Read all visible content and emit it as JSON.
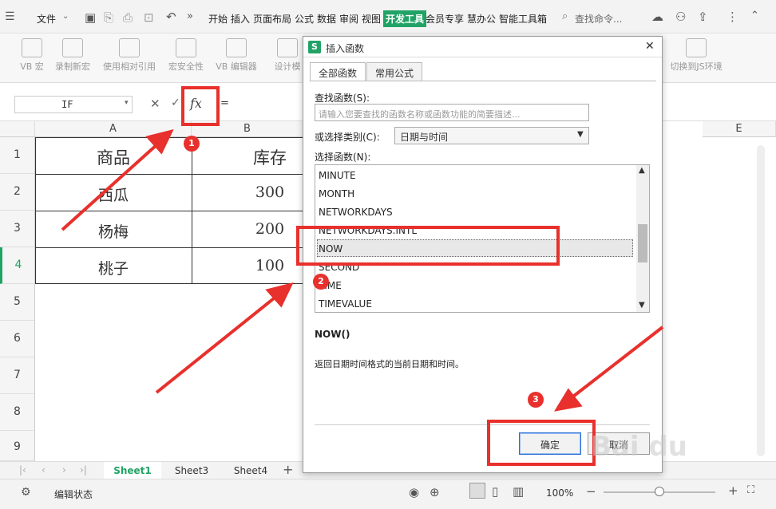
{
  "menubar": {
    "file_label": "文件",
    "items": [
      "开始",
      "插入",
      "页面布局",
      "公式",
      "数据",
      "审阅",
      "视图",
      "开发工具",
      "会员专享",
      "慧办公",
      "智能工具箱"
    ],
    "search_placeholder": "查找命令..."
  },
  "ribbon": {
    "buttons": [
      "VB 宏",
      "录制新宏",
      "使用相对引用",
      "宏安全性",
      "VB 编辑器",
      "设计模",
      "切换到JS环境"
    ]
  },
  "formula_bar": {
    "name_box": "IF",
    "fx_symbol": "fx",
    "formula": "="
  },
  "sheet": {
    "col_headers": [
      "A",
      "B",
      "E"
    ],
    "row_headers": [
      "1",
      "2",
      "3",
      "4",
      "5",
      "6",
      "7",
      "8",
      "9"
    ],
    "rows": [
      {
        "a": "商品",
        "b": "库存"
      },
      {
        "a": "西瓜",
        "b": "300"
      },
      {
        "a": "杨梅",
        "b": "200"
      },
      {
        "a": "桃子",
        "b": "100"
      }
    ]
  },
  "tabs": [
    "Sheet1",
    "Sheet3",
    "Sheet4"
  ],
  "status": {
    "mode": "编辑状态",
    "zoom": "100%"
  },
  "dialog": {
    "title": "插入函数",
    "tabs": [
      "全部函数",
      "常用公式"
    ],
    "search_label": "查找函数(S):",
    "search_placeholder": "请输入您要查找的函数名称或函数功能的简要描述...",
    "category_label": "或选择类别(C):",
    "category_value": "日期与时间",
    "list_label": "选择函数(N):",
    "functions": [
      "MINUTE",
      "MONTH",
      "NETWORKDAYS",
      "NETWORKDAYS.INTL",
      "NOW",
      "SECOND",
      "TIME",
      "TIMEVALUE"
    ],
    "selected_function": "NOW",
    "signature": "NOW()",
    "description": "返回日期时间格式的当前日期和时间。",
    "ok_label": "确定",
    "cancel_label": "取消"
  },
  "annotations": {
    "badge1": "1",
    "badge2": "2",
    "badge3": "3",
    "accent": "#e8302c"
  }
}
